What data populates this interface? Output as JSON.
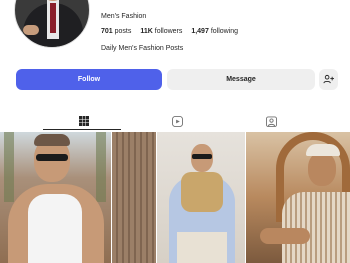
{
  "profile": {
    "name": "Men's Fashion",
    "posts_count": "701",
    "posts_label": "posts",
    "followers_count": "11K",
    "followers_label": "followers",
    "following_count": "1,497",
    "following_label": "following",
    "bio": "Daily Men's Fashion Posts"
  },
  "actions": {
    "follow_label": "Follow",
    "message_label": "Message"
  },
  "tabs": [
    {
      "name": "posts",
      "icon": "grid-icon",
      "active": true
    },
    {
      "name": "reels",
      "icon": "reels-icon",
      "active": false
    },
    {
      "name": "tagged",
      "icon": "tagged-icon",
      "active": false
    }
  ],
  "colors": {
    "follow_button": "#4f61ea",
    "secondary_button": "#efefef",
    "text": "#262626"
  }
}
